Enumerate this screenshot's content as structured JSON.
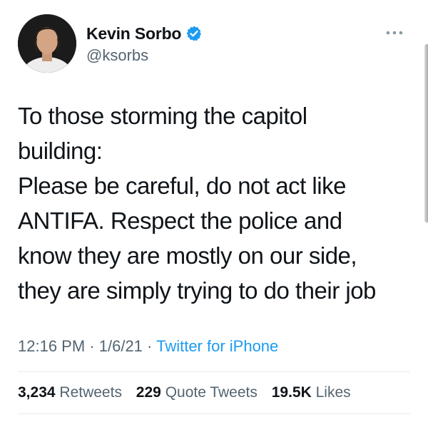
{
  "author": {
    "display_name": "Kevin Sorbo",
    "handle": "@ksorbs",
    "verified": true
  },
  "icons": {
    "verified": "verified-badge-icon",
    "more": "more-options-icon"
  },
  "tweet": {
    "lines": [
      "To those storming the capitol",
      "building:",
      "Please be careful, do not act like",
      "ANTIFA. Respect the police and",
      "know they are mostly on our side,",
      "they are simply trying to do their job"
    ]
  },
  "meta": {
    "time": "12:16 PM",
    "date": "1/6/21",
    "separator": "·",
    "source": "Twitter for iPhone"
  },
  "stats": {
    "retweets": {
      "count": "3,234",
      "label": "Retweets"
    },
    "quote_tweets": {
      "count": "229",
      "label": "Quote Tweets"
    },
    "likes": {
      "count": "19.5K",
      "label": "Likes"
    }
  },
  "colors": {
    "text": "#0f1419",
    "secondary": "#536471",
    "link": "#1d9bf0",
    "divider": "#e6ecf0"
  }
}
